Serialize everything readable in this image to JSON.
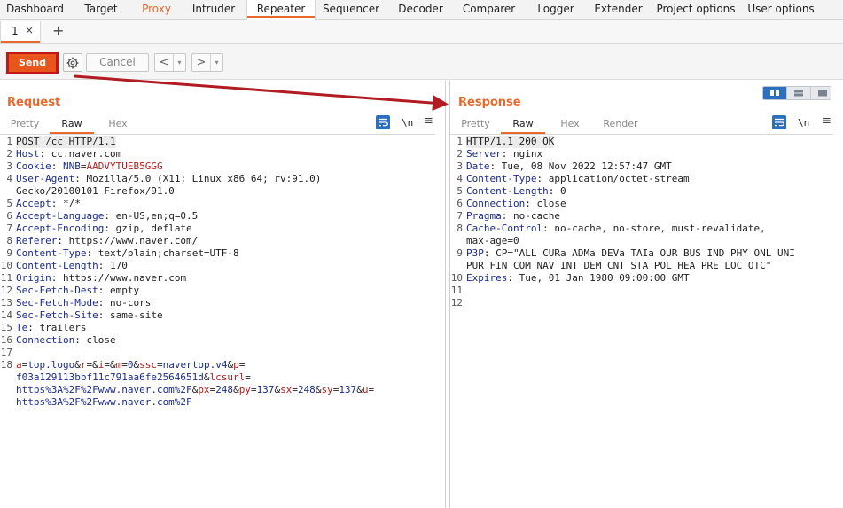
{
  "nav": {
    "tabs": [
      {
        "label": "Dashboard",
        "w": 79
      },
      {
        "label": "Target",
        "w": 70
      },
      {
        "label": "Proxy",
        "w": 55
      },
      {
        "label": "Intruder",
        "w": 74
      },
      {
        "label": "Repeater",
        "w": 78
      },
      {
        "label": "Sequencer",
        "w": 80
      },
      {
        "label": "Decoder",
        "w": 77
      },
      {
        "label": "Comparer",
        "w": 77
      },
      {
        "label": "Logger",
        "w": 74
      },
      {
        "label": "Extender",
        "w": 67
      },
      {
        "label": "Project options",
        "w": 108
      },
      {
        "label": "User options",
        "w": 84
      }
    ]
  },
  "subtabs": {
    "first": "1",
    "close": "×",
    "add": "+"
  },
  "toolbar": {
    "send": "Send",
    "cancel": "Cancel",
    "back": "<",
    "forward": ">",
    "dropdown": "▾"
  },
  "request": {
    "title": "Request",
    "tabs": [
      "Pretty",
      "Raw",
      "Hex"
    ],
    "active_tab": "Raw",
    "newline_toggle": "\\n",
    "lines": [
      {
        "n": "1",
        "parts": [
          [
            "pe",
            "POST /cc HTTP/1.1"
          ]
        ]
      },
      {
        "n": "2",
        "parts": [
          [
            "hk",
            "Host"
          ],
          [
            "hv",
            ": cc.naver.com"
          ]
        ]
      },
      {
        "n": "3",
        "parts": [
          [
            "hk",
            "Cookie"
          ],
          [
            "hv",
            ": "
          ],
          [
            "hk",
            "NNB"
          ],
          [
            "hv",
            "="
          ],
          [
            "cookie-v",
            "AADVYTUEB5GGG"
          ]
        ]
      },
      {
        "n": "4",
        "parts": [
          [
            "hk",
            "User-Agent"
          ],
          [
            "hv",
            ": Mozilla/5.0 (X11; Linux x86_64; rv:91.0)"
          ]
        ]
      },
      {
        "n": "",
        "parts": [
          [
            "hv",
            "Gecko/20100101 Firefox/91.0"
          ]
        ]
      },
      {
        "n": "5",
        "parts": [
          [
            "hk",
            "Accept"
          ],
          [
            "hv",
            ": */*"
          ]
        ]
      },
      {
        "n": "6",
        "parts": [
          [
            "hk",
            "Accept-Language"
          ],
          [
            "hv",
            ": en-US,en;q=0.5"
          ]
        ]
      },
      {
        "n": "7",
        "parts": [
          [
            "hk",
            "Accept-Encoding"
          ],
          [
            "hv",
            ": gzip, deflate"
          ]
        ]
      },
      {
        "n": "8",
        "parts": [
          [
            "hk",
            "Referer"
          ],
          [
            "hv",
            ": https://www.naver.com/"
          ]
        ]
      },
      {
        "n": "9",
        "parts": [
          [
            "hk",
            "Content-Type"
          ],
          [
            "hv",
            ": text/plain;charset=UTF-8"
          ]
        ]
      },
      {
        "n": "10",
        "parts": [
          [
            "hk",
            "Content-Length"
          ],
          [
            "hv",
            ": 170"
          ]
        ]
      },
      {
        "n": "11",
        "parts": [
          [
            "hk",
            "Origin"
          ],
          [
            "hv",
            ": https://www.naver.com"
          ]
        ]
      },
      {
        "n": "12",
        "parts": [
          [
            "hk",
            "Sec-Fetch-Dest"
          ],
          [
            "hv",
            ": empty"
          ]
        ]
      },
      {
        "n": "13",
        "parts": [
          [
            "hk",
            "Sec-Fetch-Mode"
          ],
          [
            "hv",
            ": no-cors"
          ]
        ]
      },
      {
        "n": "14",
        "parts": [
          [
            "hk",
            "Sec-Fetch-Site"
          ],
          [
            "hv",
            ": same-site"
          ]
        ]
      },
      {
        "n": "15",
        "parts": [
          [
            "hk",
            "Te"
          ],
          [
            "hv",
            ": trailers"
          ]
        ]
      },
      {
        "n": "16",
        "parts": [
          [
            "hk",
            "Connection"
          ],
          [
            "hv",
            ": close"
          ]
        ]
      },
      {
        "n": "17",
        "parts": []
      },
      {
        "n": "18",
        "parts": [
          [
            "pk",
            "a"
          ],
          [
            "pe",
            "="
          ],
          [
            "pv",
            "top.logo"
          ],
          [
            "pe",
            "&"
          ],
          [
            "pk",
            "r"
          ],
          [
            "pe",
            "=&"
          ],
          [
            "pk",
            "i"
          ],
          [
            "pe",
            "=&"
          ],
          [
            "pk",
            "m"
          ],
          [
            "pe",
            "="
          ],
          [
            "pv",
            "0"
          ],
          [
            "pe",
            "&"
          ],
          [
            "pk",
            "ssc"
          ],
          [
            "pe",
            "="
          ],
          [
            "pv",
            "navertop.v4"
          ],
          [
            "pe",
            "&"
          ],
          [
            "pk",
            "p"
          ],
          [
            "pe",
            "="
          ]
        ]
      },
      {
        "n": "",
        "parts": [
          [
            "pv",
            "f03a129113bbf11c791aa6fe2564651d"
          ],
          [
            "pe",
            "&"
          ],
          [
            "pk",
            "lcsurl"
          ],
          [
            "pe",
            "="
          ]
        ]
      },
      {
        "n": "",
        "parts": [
          [
            "pv",
            "https%3A%2F%2Fwww.naver.com%2F"
          ],
          [
            "pe",
            "&"
          ],
          [
            "pk",
            "px"
          ],
          [
            "pe",
            "="
          ],
          [
            "pv",
            "248"
          ],
          [
            "pe",
            "&"
          ],
          [
            "pk",
            "py"
          ],
          [
            "pe",
            "="
          ],
          [
            "pv",
            "137"
          ],
          [
            "pe",
            "&"
          ],
          [
            "pk",
            "sx"
          ],
          [
            "pe",
            "="
          ],
          [
            "pv",
            "248"
          ],
          [
            "pe",
            "&"
          ],
          [
            "pk",
            "sy"
          ],
          [
            "pe",
            "="
          ],
          [
            "pv",
            "137"
          ],
          [
            "pe",
            "&"
          ],
          [
            "pk",
            "u"
          ],
          [
            "pe",
            "="
          ]
        ]
      },
      {
        "n": "",
        "parts": [
          [
            "pv",
            "https%3A%2F%2Fwww.naver.com%2F"
          ]
        ]
      }
    ]
  },
  "response": {
    "title": "Response",
    "tabs": [
      "Pretty",
      "Raw",
      "Hex",
      "Render"
    ],
    "active_tab": "Raw",
    "newline_toggle": "\\n",
    "lines": [
      {
        "n": "1",
        "parts": [
          [
            "pe",
            "HTTP/1.1 200 OK"
          ]
        ]
      },
      {
        "n": "2",
        "parts": [
          [
            "hk",
            "Server"
          ],
          [
            "hv",
            ": nginx"
          ]
        ]
      },
      {
        "n": "3",
        "parts": [
          [
            "hk",
            "Date"
          ],
          [
            "hv",
            ": Tue, 08 Nov 2022 12:57:47 GMT"
          ]
        ]
      },
      {
        "n": "4",
        "parts": [
          [
            "hk",
            "Content-Type"
          ],
          [
            "hv",
            ": application/octet-stream"
          ]
        ]
      },
      {
        "n": "5",
        "parts": [
          [
            "hk",
            "Content-Length"
          ],
          [
            "hv",
            ": 0"
          ]
        ]
      },
      {
        "n": "6",
        "parts": [
          [
            "hk",
            "Connection"
          ],
          [
            "hv",
            ": close"
          ]
        ]
      },
      {
        "n": "7",
        "parts": [
          [
            "hk",
            "Pragma"
          ],
          [
            "hv",
            ": no-cache"
          ]
        ]
      },
      {
        "n": "8",
        "parts": [
          [
            "hk",
            "Cache-Control"
          ],
          [
            "hv",
            ": no-cache, no-store, must-revalidate,"
          ]
        ]
      },
      {
        "n": "",
        "parts": [
          [
            "hv",
            "max-age=0"
          ]
        ]
      },
      {
        "n": "9",
        "parts": [
          [
            "hk",
            "P3P"
          ],
          [
            "hv",
            ": CP=\"ALL CURa ADMa DEVa TAIa OUR BUS IND PHY ONL UNI"
          ]
        ]
      },
      {
        "n": "",
        "parts": [
          [
            "hv",
            "PUR FIN COM NAV INT DEM CNT STA POL HEA PRE LOC OTC\""
          ]
        ]
      },
      {
        "n": "10",
        "parts": [
          [
            "hk",
            "Expires"
          ],
          [
            "hv",
            ": Tue, 01 Jan 1980 09:00:00 GMT"
          ]
        ]
      },
      {
        "n": "11",
        "parts": []
      },
      {
        "n": "12",
        "parts": []
      }
    ]
  },
  "colors": {
    "accent": "#e8692c",
    "send_bg": "#e8561c",
    "highlight_border": "#c0161c",
    "header_key": "#1a2a8c",
    "param_key": "#b81b1b"
  }
}
